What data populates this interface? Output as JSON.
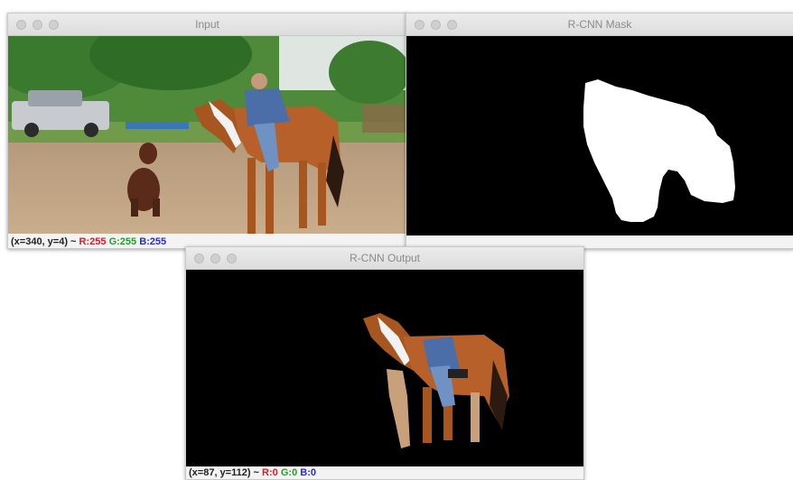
{
  "windows": {
    "input": {
      "title": "Input",
      "status": {
        "coords": "(x=340, y=4) ~ ",
        "r": "R:255",
        "g": "G:255",
        "b": "B:255"
      }
    },
    "mask": {
      "title": "R-CNN Mask"
    },
    "output": {
      "title": "R-CNN Output",
      "status": {
        "coords": "(x=87, y=112) ~ ",
        "r": "R:0",
        "g": "G:0",
        "b": "B:0"
      }
    }
  },
  "colors": {
    "canvas_black": "#000000",
    "status_red": "#d0202a",
    "status_green": "#23a02c",
    "status_blue": "#2b2bd6"
  }
}
